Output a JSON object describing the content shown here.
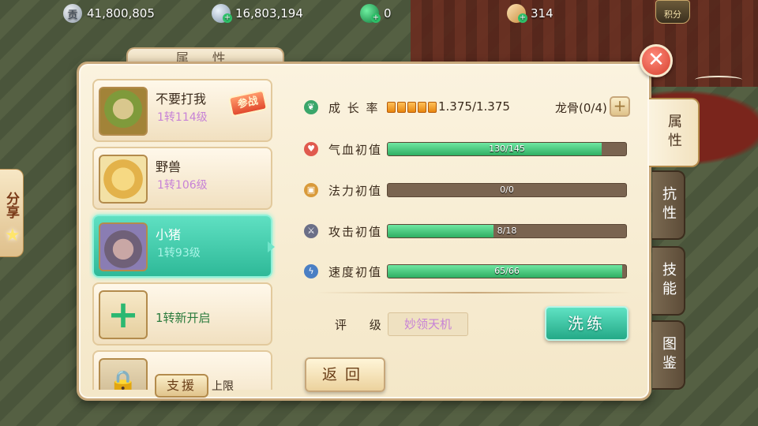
{
  "topbar": {
    "silver": "41,800,805",
    "silver_icon_glyph": "贡",
    "ingot": "16,803,194",
    "jade": "0",
    "scroll": "314",
    "score_label": "积分"
  },
  "share": {
    "label": "分享"
  },
  "panel": {
    "title": "属 性",
    "close_glyph": "✕"
  },
  "pets": [
    {
      "name": "不要打我",
      "level": "1转114级",
      "badge": "参战"
    },
    {
      "name": "野兽",
      "level": "1转106级"
    },
    {
      "name": "小猪",
      "level": "1转93级",
      "selected": true
    },
    {
      "name": "1转新开启"
    },
    {
      "name": "上限"
    }
  ],
  "support_label": "支援",
  "attributes": {
    "growth": {
      "label": "成 长 率",
      "value": "1.375/1.375",
      "blocks": 5
    },
    "dragon_bone": "龙骨(0/4)",
    "dragon_plus": "+",
    "hp": {
      "label": "气血初值",
      "text": "130/145",
      "fraction": 0.897
    },
    "mp": {
      "label": "法力初值",
      "text": "0/0",
      "fraction": 0
    },
    "atk": {
      "label": "攻击初值",
      "text": "8/18",
      "fraction": 0.444
    },
    "spd": {
      "label": "速度初值",
      "text": "65/66",
      "fraction": 0.985
    }
  },
  "rating": {
    "label": "评 级",
    "value": "妙领天机"
  },
  "buttons": {
    "wash": "洗练",
    "back": "返回"
  },
  "tabs": [
    "属性",
    "抗性",
    "技能",
    "图鉴"
  ],
  "colors": {
    "bar_fill": "#2fae62",
    "selected": "#2eb998",
    "level_text": "#c782d6"
  }
}
